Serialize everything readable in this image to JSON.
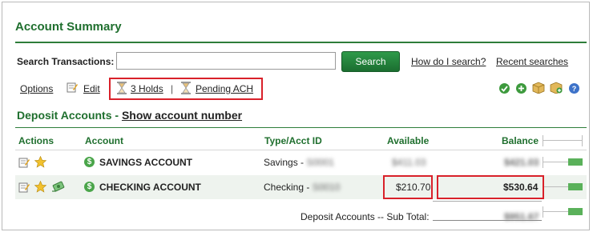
{
  "header": {
    "title": "Account Summary"
  },
  "search": {
    "label": "Search Transactions:",
    "value": "",
    "placeholder": "",
    "button_label": "Search",
    "help_link": "How do I search?",
    "recent_link": "Recent searches"
  },
  "toolbar": {
    "options_label": "Options",
    "edit_label": "Edit",
    "holds_label": "3 Holds",
    "separator": "|",
    "pending_label": "Pending ACH",
    "right_icons": [
      "check-circle-icon",
      "add-circle-icon",
      "package-icon",
      "package-add-icon",
      "help-circle-icon"
    ]
  },
  "section": {
    "title": "Deposit Accounts - ",
    "show_account_number": "Show account number"
  },
  "table": {
    "headers": {
      "actions": "Actions",
      "account": "Account",
      "type": "Type/Acct ID",
      "available": "Available",
      "balance": "Balance"
    },
    "rows": [
      {
        "name": "SAVINGS ACCOUNT",
        "type": "Savings - ",
        "acct_id": "S0001",
        "available": "$411.03",
        "balance": "$421.03"
      },
      {
        "name": "CHECKING ACCOUNT",
        "type": "Checking - ",
        "acct_id": "S0010",
        "available": "$210.70",
        "balance": "$530.64"
      }
    ],
    "subtotal_label": "Deposit Accounts -- Sub Total:",
    "subtotal_value": "$951.67"
  },
  "colors": {
    "accent": "#1f6f2e",
    "highlight": "#d9212a",
    "button": "#1b6e30"
  }
}
